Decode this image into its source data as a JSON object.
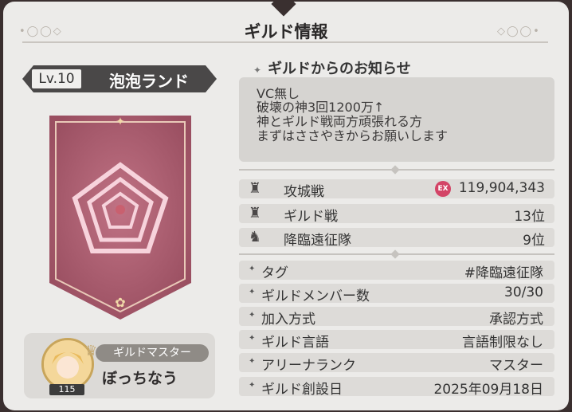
{
  "window": {
    "title": "ギルド情報"
  },
  "guild": {
    "level": "Lv.10",
    "name": "泡泡ランド"
  },
  "master": {
    "label": "ギルドマスター",
    "name": "ぼっちなう",
    "level": "115"
  },
  "notice": {
    "heading": "ギルドからのお知らせ",
    "lines": [
      "VC無し",
      "破壊の神3回1200万↑",
      "神とギルド戦両方頑張れる方",
      "まずはささやきからお願いします"
    ]
  },
  "stats": [
    {
      "icon": "castle-siege-icon",
      "label": "攻城戦",
      "value": "119,904,343",
      "badge": "EX"
    },
    {
      "icon": "guild-war-icon",
      "label": "ギルド戦",
      "value": "13位"
    },
    {
      "icon": "descent-expedition-icon",
      "label": "降臨遠征隊",
      "value": "9位"
    }
  ],
  "info": [
    {
      "label": "タグ",
      "value": "#降臨遠征隊"
    },
    {
      "label": "ギルドメンバー数",
      "value": "30/30"
    },
    {
      "label": "加入方式",
      "value": "承認方式"
    },
    {
      "label": "ギルド言語",
      "value": "言語制限なし"
    },
    {
      "label": "アリーナランク",
      "value": "マスター"
    },
    {
      "label": "ギルド創設日",
      "value": "2025年09月18日"
    }
  ],
  "colors": {
    "banner": "#b35f73",
    "panel": "#ecebe9",
    "row": "#dddbd8",
    "accent": "#c7ab74"
  }
}
